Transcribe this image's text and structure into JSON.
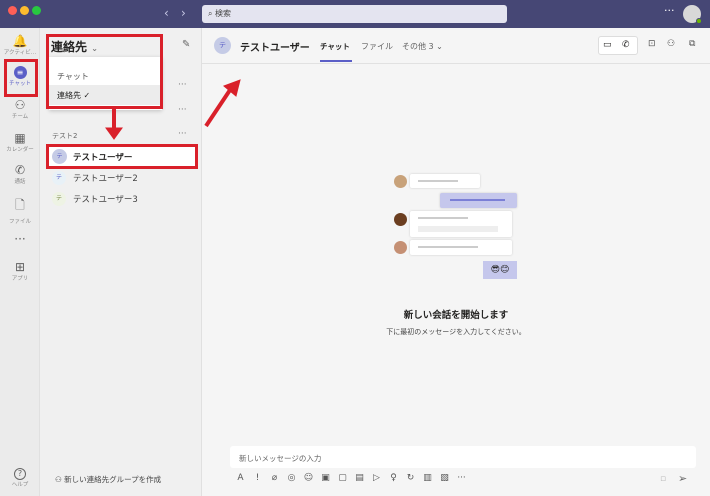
{
  "titlebar": {
    "search_placeholder": "検索",
    "back_icon": "‹",
    "forward_icon": "›",
    "more": "···"
  },
  "rail": [
    {
      "label": "アクティビ…",
      "icon": "bell-icon",
      "glyph": "🔔"
    },
    {
      "label": "チャット",
      "icon": "chat-icon",
      "glyph": "≡"
    },
    {
      "label": "チーム",
      "icon": "teams-icon",
      "glyph": "⚇"
    },
    {
      "label": "カレンダー",
      "icon": "calendar-icon",
      "glyph": "▦"
    },
    {
      "label": "通話",
      "icon": "phone-icon",
      "glyph": "✆"
    },
    {
      "label": "ファイル",
      "icon": "file-icon",
      "glyph": "🗋"
    },
    {
      "label": "",
      "icon": "more-icon",
      "glyph": "···"
    },
    {
      "label": "アプリ",
      "icon": "apps-icon",
      "glyph": "⊞"
    },
    {
      "label": "ヘルプ",
      "icon": "help-icon",
      "glyph": "?"
    }
  ],
  "list": {
    "title": "連絡先",
    "dropdown": [
      {
        "label": "チャット",
        "checked": false
      },
      {
        "label": "連絡先",
        "checked": true
      }
    ],
    "group": "テスト2",
    "contacts": [
      {
        "name": "テストユーザー",
        "initial": "テ",
        "selected": true
      },
      {
        "name": "テストユーザー2",
        "initial": "テ"
      },
      {
        "name": "テストユーザー3",
        "initial": "テ"
      }
    ],
    "more": "···",
    "new_group": "新しい連絡先グループを作成"
  },
  "header": {
    "name": "テストユーザー",
    "initial": "テ",
    "tabs": [
      "チャット",
      "ファイル",
      "その他 3 ⌄"
    ]
  },
  "empty": {
    "title": "新しい会話を開始します",
    "subtitle": "下に最初のメッセージを入力してください。",
    "emoji": "😎😊"
  },
  "compose": {
    "placeholder": "新しいメッセージの入力"
  },
  "colors": {
    "titlebar": "#464775",
    "accent": "#5b5fc7",
    "annotation": "#d9202a"
  }
}
